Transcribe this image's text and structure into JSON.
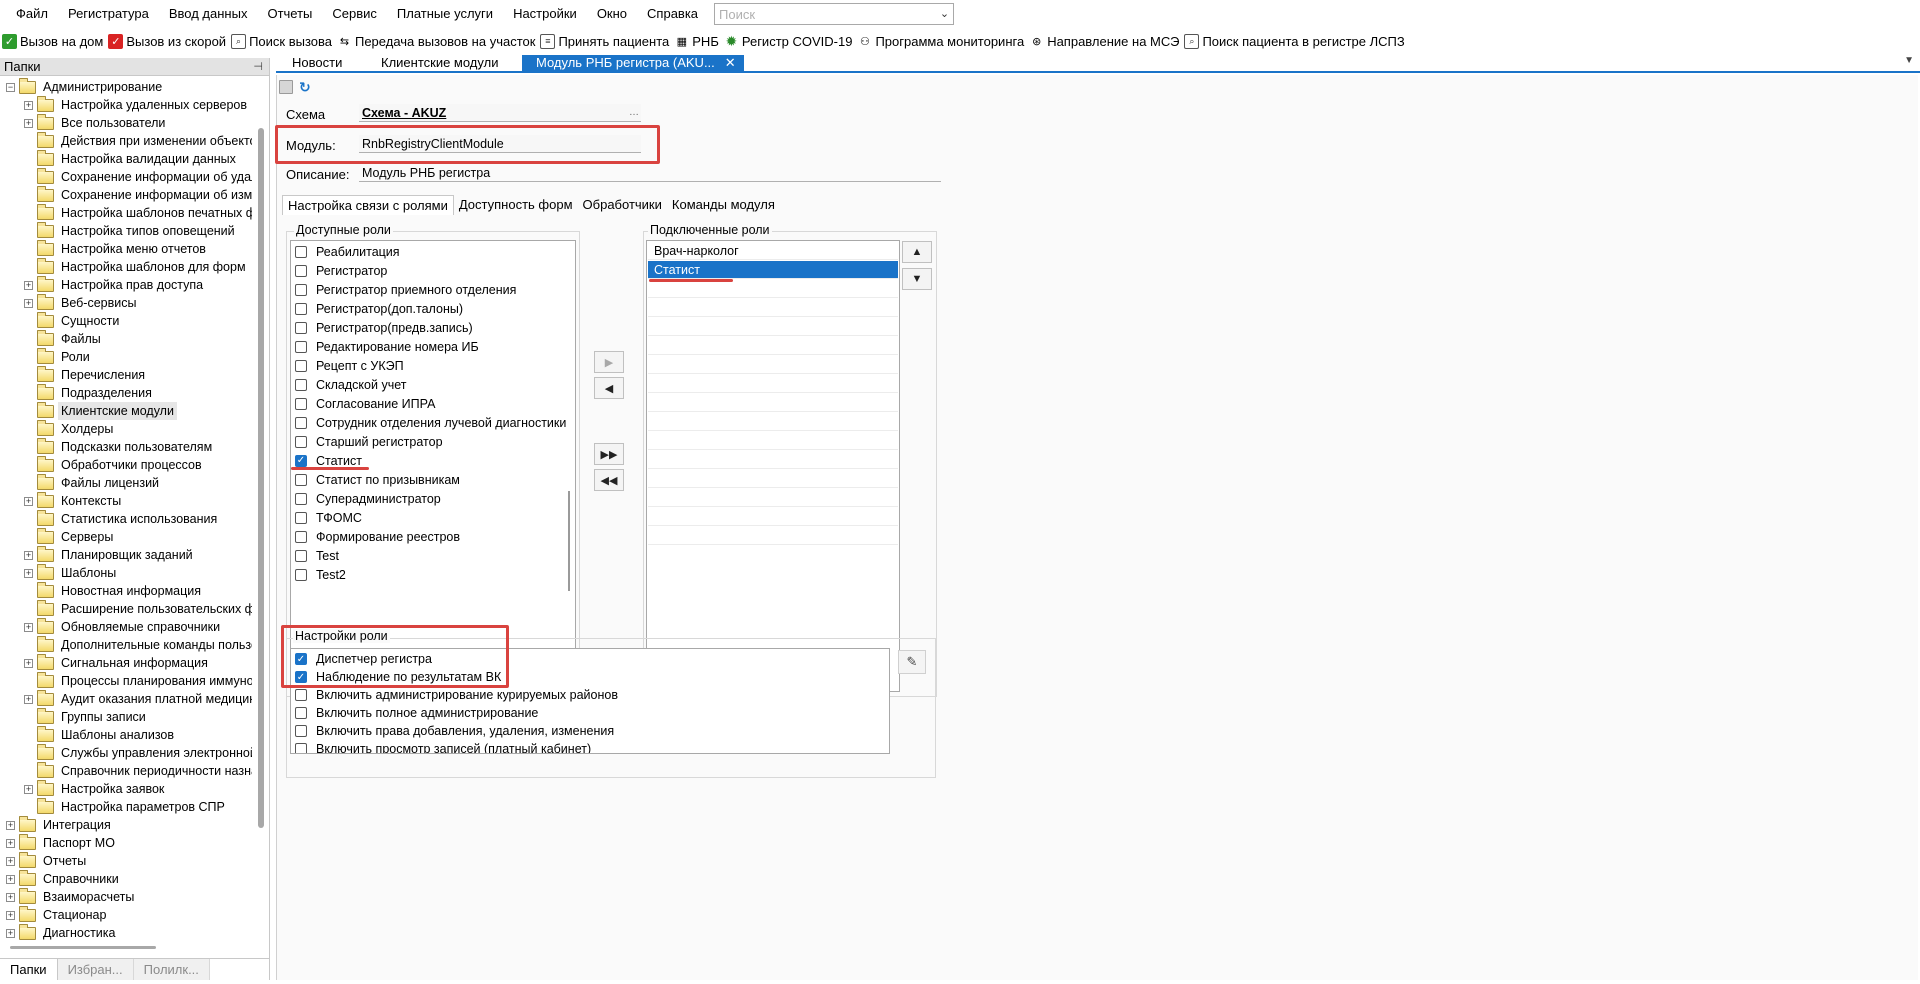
{
  "menu": {
    "items": [
      "Файл",
      "Регистратура",
      "Ввод данных",
      "Отчеты",
      "Сервис",
      "Платные услуги",
      "Настройки",
      "Окно",
      "Справка"
    ],
    "search_placeholder": "Поиск"
  },
  "toolbar": {
    "buttons": [
      {
        "label": "Вызов на дом",
        "icon": "green-check-icon"
      },
      {
        "label": "Вызов из скорой",
        "icon": "red-check-icon"
      },
      {
        "label": "Поиск вызова",
        "icon": "search-doc-icon"
      },
      {
        "label": "Передача вызовов на участок",
        "icon": "transfer-icon"
      },
      {
        "label": "Принять пациента",
        "icon": "accept-doc-icon"
      },
      {
        "label": "РНБ",
        "icon": "rnb-icon"
      },
      {
        "label": "Регистр COVID-19",
        "icon": "covid-icon"
      },
      {
        "label": "Программа мониторинга",
        "icon": "monitoring-icon"
      },
      {
        "label": "Направление на МСЭ",
        "icon": "mse-icon"
      },
      {
        "label": "Поиск пациента в регистре ЛСПЗ",
        "icon": "search-doc-icon"
      }
    ]
  },
  "left_panel": {
    "title": "Папки",
    "tree": [
      {
        "label": "Администрирование",
        "level": 0,
        "exp": "−"
      },
      {
        "label": "Настройка удаленных серверов",
        "level": 1,
        "exp": "+"
      },
      {
        "label": "Все пользователи",
        "level": 1,
        "exp": "+"
      },
      {
        "label": "Действия при изменении объекто",
        "level": 1,
        "exp": ""
      },
      {
        "label": "Настройка валидации данных",
        "level": 1,
        "exp": ""
      },
      {
        "label": "Сохранение информации об удал",
        "level": 1,
        "exp": ""
      },
      {
        "label": "Сохранение информации об изме",
        "level": 1,
        "exp": ""
      },
      {
        "label": "Настройка шаблонов печатных ф",
        "level": 1,
        "exp": ""
      },
      {
        "label": "Настройка типов оповещений",
        "level": 1,
        "exp": ""
      },
      {
        "label": "Настройка меню отчетов",
        "level": 1,
        "exp": ""
      },
      {
        "label": "Настройка шаблонов для форм",
        "level": 1,
        "exp": ""
      },
      {
        "label": "Настройка прав доступа",
        "level": 1,
        "exp": "+"
      },
      {
        "label": "Веб-сервисы",
        "level": 1,
        "exp": "+"
      },
      {
        "label": "Сущности",
        "level": 1,
        "exp": ""
      },
      {
        "label": "Файлы",
        "level": 1,
        "exp": ""
      },
      {
        "label": "Роли",
        "level": 1,
        "exp": ""
      },
      {
        "label": "Перечисления",
        "level": 1,
        "exp": ""
      },
      {
        "label": "Подразделения",
        "level": 1,
        "exp": ""
      },
      {
        "label": "Клиентские модули",
        "level": 1,
        "exp": "",
        "selected": true
      },
      {
        "label": "Холдеры",
        "level": 1,
        "exp": ""
      },
      {
        "label": "Подсказки пользователям",
        "level": 1,
        "exp": ""
      },
      {
        "label": "Обработчики процессов",
        "level": 1,
        "exp": ""
      },
      {
        "label": "Файлы лицензий",
        "level": 1,
        "exp": ""
      },
      {
        "label": "Контексты",
        "level": 1,
        "exp": "+"
      },
      {
        "label": "Статистика использования",
        "level": 1,
        "exp": ""
      },
      {
        "label": "Серверы",
        "level": 1,
        "exp": ""
      },
      {
        "label": "Планировщик заданий",
        "level": 1,
        "exp": "+"
      },
      {
        "label": "Шаблоны",
        "level": 1,
        "exp": "+"
      },
      {
        "label": "Новостная информация",
        "level": 1,
        "exp": ""
      },
      {
        "label": "Расширение пользовательских фо",
        "level": 1,
        "exp": ""
      },
      {
        "label": "Обновляемые справочники",
        "level": 1,
        "exp": "+"
      },
      {
        "label": "Дополнительные команды пользо",
        "level": 1,
        "exp": ""
      },
      {
        "label": "Сигнальная информация",
        "level": 1,
        "exp": "+"
      },
      {
        "label": "Процессы планирования иммуно",
        "level": 1,
        "exp": ""
      },
      {
        "label": "Аудит оказания платной медицин",
        "level": 1,
        "exp": "+"
      },
      {
        "label": "Группы записи",
        "level": 1,
        "exp": ""
      },
      {
        "label": "Шаблоны анализов",
        "level": 1,
        "exp": ""
      },
      {
        "label": "Службы управления электронной",
        "level": 1,
        "exp": ""
      },
      {
        "label": "Справочник периодичности назна",
        "level": 1,
        "exp": ""
      },
      {
        "label": "Настройка заявок",
        "level": 1,
        "exp": "+"
      },
      {
        "label": "Настройка параметров СПР",
        "level": 1,
        "exp": ""
      },
      {
        "label": "Интеграция",
        "level": 0,
        "exp": "+"
      },
      {
        "label": "Паспорт МО",
        "level": 0,
        "exp": "+"
      },
      {
        "label": "Отчеты",
        "level": 0,
        "exp": "+"
      },
      {
        "label": "Справочники",
        "level": 0,
        "exp": "+"
      },
      {
        "label": "Взаиморасчеты",
        "level": 0,
        "exp": "+"
      },
      {
        "label": "Стационар",
        "level": 0,
        "exp": "+"
      },
      {
        "label": "Диагностика",
        "level": 0,
        "exp": "+"
      }
    ],
    "bottom_tabs": [
      "Папки",
      "Избран...",
      "Полилк..."
    ]
  },
  "doc_tabs": [
    "Новости",
    "Клиентские модули",
    "Модуль РНБ регистра (AKU..."
  ],
  "form": {
    "schema_label": "Схема",
    "schema_value": "Схема - AKUZ",
    "module_label": "Модуль:",
    "module_value": "RnbRegistryClientModule",
    "description_label": "Описание:",
    "description_value": "Модуль РНБ регистра"
  },
  "sub_tabs": [
    "Настройка связи с ролями",
    "Доступность форм",
    "Обработчики",
    "Команды модуля"
  ],
  "available_roles": {
    "title": "Доступные роли",
    "items": [
      {
        "label": "Реабилитация",
        "checked": false
      },
      {
        "label": "Регистратор",
        "checked": false
      },
      {
        "label": "Регистратор приемного отделения",
        "checked": false
      },
      {
        "label": "Регистратор(доп.талоны)",
        "checked": false
      },
      {
        "label": "Регистратор(предв.запись)",
        "checked": false
      },
      {
        "label": "Редактирование номера ИБ",
        "checked": false
      },
      {
        "label": "Рецепт с УКЭП",
        "checked": false
      },
      {
        "label": "Складской учет",
        "checked": false
      },
      {
        "label": "Согласование ИПРА",
        "checked": false
      },
      {
        "label": "Сотрудник отделения лучевой диагностики",
        "checked": false
      },
      {
        "label": "Старший регистратор",
        "checked": false
      },
      {
        "label": "Статист",
        "checked": true
      },
      {
        "label": "Статист по призывникам",
        "checked": false
      },
      {
        "label": "Суперадминистратор",
        "checked": false
      },
      {
        "label": "ТФОМС",
        "checked": false
      },
      {
        "label": "Формирование реестров",
        "checked": false
      },
      {
        "label": "Test",
        "checked": false
      },
      {
        "label": "Test2",
        "checked": false
      }
    ]
  },
  "connected_roles": {
    "title": "Подключенные роли",
    "items": [
      {
        "label": "Врач-нарколог",
        "selected": false
      },
      {
        "label": "Статист",
        "selected": true
      }
    ]
  },
  "role_settings": {
    "title": "Настройки роли",
    "items": [
      {
        "label": "Диспетчер регистра",
        "checked": true
      },
      {
        "label": "Наблюдение по результатам ВК",
        "checked": true
      },
      {
        "label": "Включить администрирование курируемых районов",
        "checked": false
      },
      {
        "label": "Включить полное администрирование",
        "checked": false
      },
      {
        "label": "Включить права добавления, удаления, изменения",
        "checked": false
      },
      {
        "label": "Включить просмотр записей (платный кабинет)",
        "checked": false
      }
    ]
  },
  "colors": {
    "accent": "#1a73c8",
    "highlight": "#d9433f"
  }
}
